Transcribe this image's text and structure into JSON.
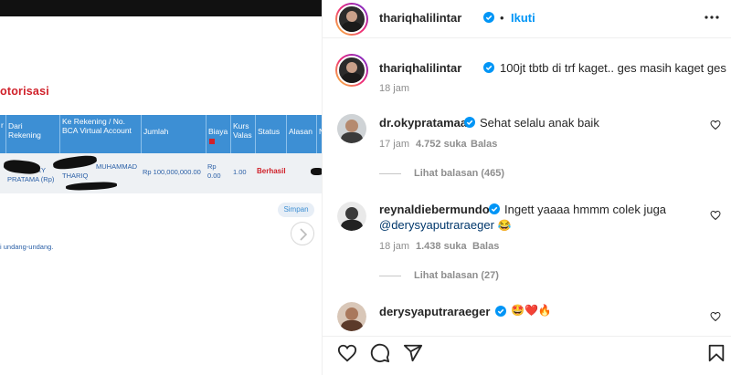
{
  "bank": {
    "title_fragment": "otorisasi",
    "headers": {
      "col_r": "r",
      "dari": "Dari Rekening",
      "ke": "Ke Rekening / No. BCA Virtual Account",
      "jumlah": "Jumlah",
      "biaya": "Biaya",
      "kurs": "Kurs Valas",
      "status": "Status",
      "alasan": "Alasan",
      "col_n": "N"
    },
    "row": {
      "dari_line1": "/ OKY",
      "dari_line2": "PRATAMA (Rp)",
      "ke_line1": "MUHAMMAD",
      "ke_line2": "THARIQ",
      "jumlah": "Rp 100,000,000.00",
      "biaya_line1": "Rp",
      "biaya_line2": "0.00",
      "kurs": "1.00",
      "status": "Berhasil"
    },
    "simpan": "Simpan",
    "footer_note": "i undang-undang."
  },
  "post": {
    "author": "thariqhalilintar",
    "follow_label": "Ikuti",
    "dot": "•",
    "caption_user": "thariqhalilintar",
    "caption_text": "100jt tbtb di trf kaget.. ges masih kaget ges",
    "caption_time": "18 jam"
  },
  "comments": [
    {
      "user": "dr.okypratamaa",
      "text": "Sehat selalu anak baik",
      "time": "17 jam",
      "likes": "4.752 suka",
      "reply": "Balas",
      "view_replies": "Lihat balasan (465)"
    },
    {
      "user": "reynaldiebermundo",
      "text": "Ingett yaaaa hmmm colek juga",
      "mention": "@derysyaputraraeger",
      "emoji": "😂",
      "time": "18 jam",
      "likes": "1.438 suka",
      "reply": "Balas",
      "view_replies": "Lihat balasan (27)"
    },
    {
      "user": "derysyaputraraeger",
      "emoji": "🤩❤️🔥"
    }
  ],
  "icons": {
    "verified": "verified-badge-icon",
    "more": "more-options-icon",
    "like": "heart-icon",
    "comment": "comment-icon",
    "share": "share-icon",
    "save": "bookmark-icon"
  },
  "colors": {
    "link_blue": "#0095f6",
    "table_header": "#3d8fd4",
    "status_red": "#d0212a",
    "muted": "#8e8e8e"
  }
}
